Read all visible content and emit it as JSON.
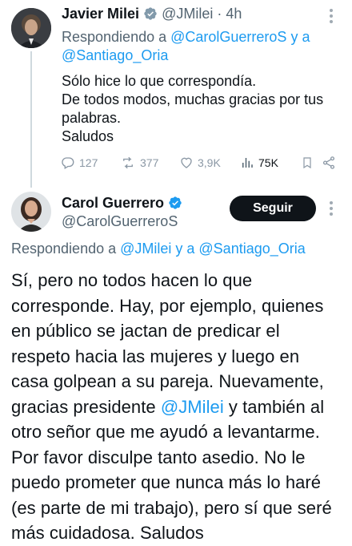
{
  "tweet1": {
    "name": "Javier Milei",
    "handle": "@JMilei",
    "separator": "·",
    "time": "4h",
    "reply_prefix": "Respondiendo a ",
    "reply_user1": "@CarolGuerreroS",
    "reply_joiner": " y a",
    "reply_user2": "@Santiago_Oria",
    "lines": [
      "Sólo hice lo que correspondía.",
      "De todos modos, muchas gracias por tus",
      "palabras.",
      "Saludos"
    ],
    "stats": {
      "replies": "127",
      "retweets": "377",
      "likes": "3,9K",
      "views": "75K"
    }
  },
  "tweet2": {
    "name": "Carol Guerrero",
    "handle": "@CarolGuerreroS",
    "follow_label": "Seguir",
    "reply_prefix": "Respondiendo a ",
    "reply_user1": "@JMilei",
    "reply_joiner": " y a ",
    "reply_user2": "@Santiago_Oria",
    "lines": [
      {
        "text": "Sí, pero no todos hacen lo que"
      },
      {
        "text": "corresponde. Hay, por ejemplo, quienes"
      },
      {
        "text": "en público se jactan de predicar el"
      },
      {
        "text": "respeto hacia las mujeres y luego en"
      },
      {
        "text": "casa golpean a su pareja. Nuevamente,"
      },
      {
        "pre": "gracias presidente ",
        "mention": "@JMilei",
        "post": " y también al"
      },
      {
        "text": "otro señor que me ayudó a levantarme."
      },
      {
        "text": "Por favor disculpe tanto asedio. No le"
      },
      {
        "text": "puedo prometer que nunca más lo haré"
      },
      {
        "text": "(es parte de mi trabajo), pero sí que seré"
      },
      {
        "text": "más cuidadosa. Saludos"
      }
    ]
  },
  "icons": {
    "verified": "verified-badge-icon",
    "more": "more-vertical-icon",
    "reply": "reply-icon",
    "retweet": "retweet-icon",
    "like": "heart-icon",
    "views": "views-icon",
    "bookmark": "bookmark-icon",
    "share": "share-icon"
  },
  "colors": {
    "link": "#1d9bf0",
    "text": "#0f1419",
    "muted": "#536471",
    "verified": "#1d9bf0",
    "button": "#0f1419"
  }
}
